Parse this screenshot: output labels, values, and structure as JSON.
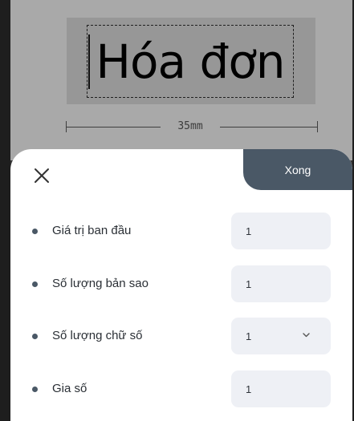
{
  "preview": {
    "label_text": "Hóa đơn",
    "width_label": "35mm"
  },
  "sheet": {
    "close_icon": "close-icon",
    "done_label": "Xong",
    "rows": [
      {
        "label": "Giá trị ban đầu",
        "value": "1",
        "type": "input"
      },
      {
        "label": "Số lượng bản sao",
        "value": "1",
        "type": "input"
      },
      {
        "label": "Số lượng chữ số",
        "value": "1",
        "type": "select"
      },
      {
        "label": "Gia số",
        "value": "1",
        "type": "input"
      }
    ]
  },
  "colors": {
    "accent": "#4a5866",
    "field_bg": "#eef0f5",
    "backdrop": "#a9a9a9"
  }
}
